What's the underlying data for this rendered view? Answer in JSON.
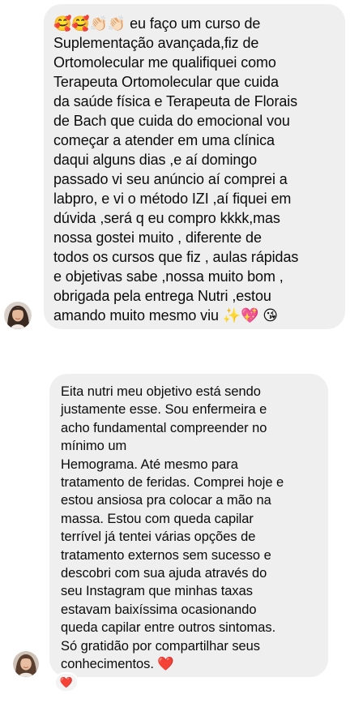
{
  "messages": [
    {
      "text": "🥰🥰👏🏻👏🏻 eu faço um curso de\nSuplementação avançada,fiz de\nOrtomolecular me qualifiquei como\nTerapeuta Ortomolecular que cuida\nda saúde física e Terapeuta de Florais\nde Bach que cuida do emocional vou\ncomeçar a atender em uma clínica\ndaqui alguns dias ,e aí domingo\npassado vi seu anúncio aí comprei a\nlabpro, e vi o método IZI ,aí fiquei em\ndúvida ,será q eu compro kkkk,mas\nnossa gostei muito , diferente de\ntodos os cursos que fiz ,  aulas rápidas\ne objetivas sabe ,nossa muito bom ,\nobrigada pela entrega Nutri ,estou\namando muito mesmo viu ✨💖 😘"
    },
    {
      "text": "Eita nutri meu objetivo está sendo\njustamente esse. Sou enfermeira e\nacho fundamental compreender no\nmínimo um\nHemograma. Até mesmo para\ntratamento de feridas. Comprei hoje e\nestou ansiosa pra colocar a mão na\nmassa. Estou com queda capilar\nterrível  já tentei várias opções de\ntratamento externos sem sucesso e\ndescobri com sua ajuda através do\nseu Instagram que minhas taxas\nestavam baixíssima ocasionando\nqueda capilar entre outros sintomas.\nSó gratidão por compartilhar seus\nconhecimentos. ❤️",
      "reaction": "❤️"
    }
  ],
  "colors": {
    "bubble": "#efefef",
    "text": "#0b0b0b",
    "reaction_heart": "#e0245e"
  }
}
